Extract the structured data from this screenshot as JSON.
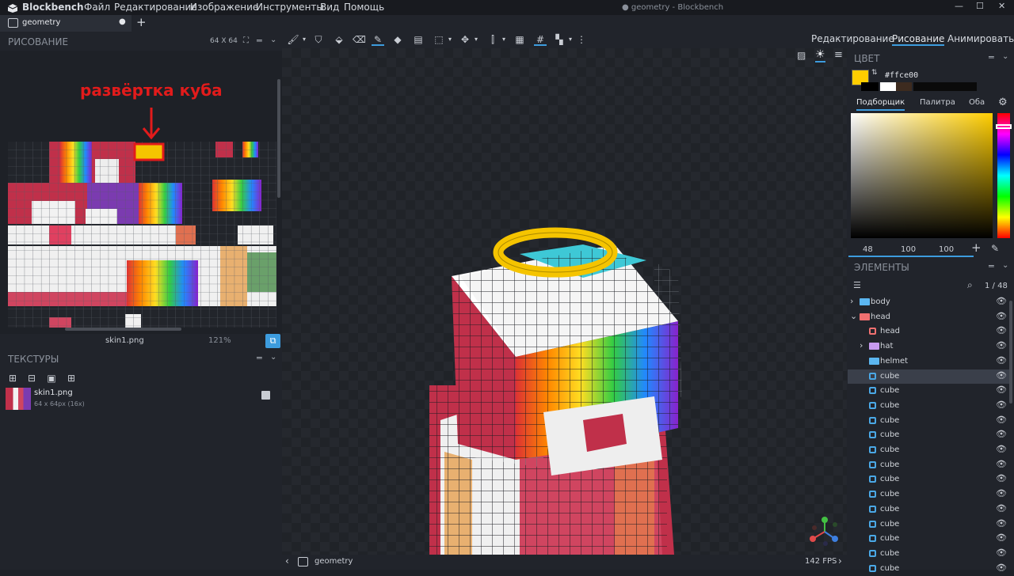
{
  "app": {
    "name": "Blockbench",
    "window_title": "● geometry - Blockbench"
  },
  "menu": [
    "Файл",
    "Редактирование",
    "Изображение",
    "Инструменты",
    "Вид",
    "Помощь"
  ],
  "window_controls": [
    "—",
    "☐",
    "✕"
  ],
  "tab": {
    "label": "geometry",
    "dot": "●",
    "add": "+"
  },
  "modes": [
    "Редактирование",
    "Рисование",
    "Анимировать"
  ],
  "active_mode": "Рисование",
  "uv_panel": {
    "title": "РИСОВАНИЕ",
    "size": "64 X 64",
    "annotation": "развёртка куба",
    "file": "skin1.png",
    "zoom": "121%"
  },
  "textures_panel": {
    "title": "ТЕКСТУРЫ",
    "texture_name": "skin1.png",
    "texture_info": "64 x 64px (16x)"
  },
  "color_panel": {
    "title": "ЦВЕТ",
    "hex": "#ffce00",
    "tabs": [
      "Подборщик",
      "Палитра",
      "Оба"
    ],
    "active_tab": "Подборщик",
    "hsv": [
      "48",
      "100",
      "100"
    ],
    "selected": "#ffce00",
    "recent": [
      "#000000",
      "#ffffff",
      "#3d2b1f",
      "#000000",
      "#000000",
      "#000000"
    ]
  },
  "elements_panel": {
    "title": "ЭЛЕМЕНТЫ",
    "count": "1 / 48",
    "rows": [
      {
        "label": "body",
        "kind": "folder",
        "color": "#5bb6f0",
        "level": 0,
        "arrow": "›"
      },
      {
        "label": "head",
        "kind": "folder",
        "color": "#f07070",
        "level": 0,
        "arrow": "⌄"
      },
      {
        "label": "head",
        "kind": "cube-red",
        "color": "#f07070",
        "level": 1,
        "arrow": ""
      },
      {
        "label": "hat",
        "kind": "folder",
        "color": "#c79af0",
        "level": 1,
        "arrow": "›"
      },
      {
        "label": "helmet",
        "kind": "folder",
        "color": "#5bb6f0",
        "level": 1,
        "arrow": ""
      },
      {
        "label": "cube",
        "kind": "cube",
        "color": "#4aa8e6",
        "level": 1,
        "arrow": "",
        "selected": true
      },
      {
        "label": "cube",
        "kind": "cube",
        "color": "#4aa8e6",
        "level": 1,
        "arrow": ""
      },
      {
        "label": "cube",
        "kind": "cube",
        "color": "#4aa8e6",
        "level": 1,
        "arrow": ""
      },
      {
        "label": "cube",
        "kind": "cube",
        "color": "#4aa8e6",
        "level": 1,
        "arrow": ""
      },
      {
        "label": "cube",
        "kind": "cube",
        "color": "#4aa8e6",
        "level": 1,
        "arrow": ""
      },
      {
        "label": "cube",
        "kind": "cube",
        "color": "#4aa8e6",
        "level": 1,
        "arrow": ""
      },
      {
        "label": "cube",
        "kind": "cube",
        "color": "#4aa8e6",
        "level": 1,
        "arrow": ""
      },
      {
        "label": "cube",
        "kind": "cube",
        "color": "#4aa8e6",
        "level": 1,
        "arrow": ""
      },
      {
        "label": "cube",
        "kind": "cube",
        "color": "#4aa8e6",
        "level": 1,
        "arrow": ""
      },
      {
        "label": "cube",
        "kind": "cube",
        "color": "#4aa8e6",
        "level": 1,
        "arrow": ""
      },
      {
        "label": "cube",
        "kind": "cube",
        "color": "#4aa8e6",
        "level": 1,
        "arrow": ""
      },
      {
        "label": "cube",
        "kind": "cube",
        "color": "#4aa8e6",
        "level": 1,
        "arrow": ""
      },
      {
        "label": "cube",
        "kind": "cube",
        "color": "#4aa8e6",
        "level": 1,
        "arrow": ""
      },
      {
        "label": "cube",
        "kind": "cube",
        "color": "#4aa8e6",
        "level": 1,
        "arrow": ""
      }
    ]
  },
  "viewport": {
    "model_name": "geometry",
    "fps": "142 FPS"
  },
  "accent": "#3d9cde"
}
